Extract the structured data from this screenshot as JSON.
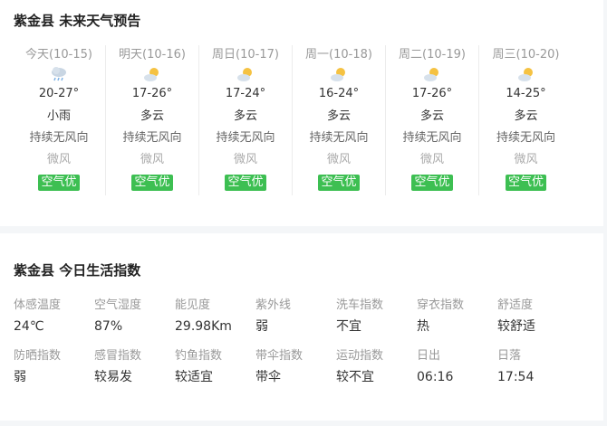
{
  "forecast": {
    "title": "紫金县 未来天气预告",
    "days": [
      {
        "date": "今天(10-15)",
        "icon": "rain-cloud-icon",
        "temp": "20-27°",
        "cond": "小雨",
        "wind": "持续无风向",
        "wind_level": "微风",
        "aqi": "空气优"
      },
      {
        "date": "明天(10-16)",
        "icon": "partly-cloudy-icon",
        "temp": "17-26°",
        "cond": "多云",
        "wind": "持续无风向",
        "wind_level": "微风",
        "aqi": "空气优"
      },
      {
        "date": "周日(10-17)",
        "icon": "partly-cloudy-icon",
        "temp": "17-24°",
        "cond": "多云",
        "wind": "持续无风向",
        "wind_level": "微风",
        "aqi": "空气优"
      },
      {
        "date": "周一(10-18)",
        "icon": "partly-cloudy-icon",
        "temp": "16-24°",
        "cond": "多云",
        "wind": "持续无风向",
        "wind_level": "微风",
        "aqi": "空气优"
      },
      {
        "date": "周二(10-19)",
        "icon": "partly-cloudy-icon",
        "temp": "17-26°",
        "cond": "多云",
        "wind": "持续无风向",
        "wind_level": "微风",
        "aqi": "空气优"
      },
      {
        "date": "周三(10-20)",
        "icon": "partly-cloudy-icon",
        "temp": "14-25°",
        "cond": "多云",
        "wind": "持续无风向",
        "wind_level": "微风",
        "aqi": "空气优"
      }
    ]
  },
  "life": {
    "title": "紫金县 今日生活指数",
    "rows": [
      [
        {
          "label": "体感温度",
          "value": "24℃"
        },
        {
          "label": "空气湿度",
          "value": "87%"
        },
        {
          "label": "能见度",
          "value": "29.98Km"
        },
        {
          "label": "紫外线",
          "value": "弱"
        },
        {
          "label": "洗车指数",
          "value": "不宜"
        },
        {
          "label": "穿衣指数",
          "value": "热"
        },
        {
          "label": "舒适度",
          "value": "较舒适"
        }
      ],
      [
        {
          "label": "防晒指数",
          "value": "弱"
        },
        {
          "label": "感冒指数",
          "value": "较易发"
        },
        {
          "label": "钓鱼指数",
          "value": "较适宜"
        },
        {
          "label": "带伞指数",
          "value": "带伞"
        },
        {
          "label": "运动指数",
          "value": "较不宜"
        },
        {
          "label": "日出",
          "value": "06:16"
        },
        {
          "label": "日落",
          "value": "17:54"
        }
      ]
    ]
  },
  "colors": {
    "aqi_good": "#3dbf52",
    "sun": "#f5c242",
    "cloud": "#c9d6e3"
  }
}
